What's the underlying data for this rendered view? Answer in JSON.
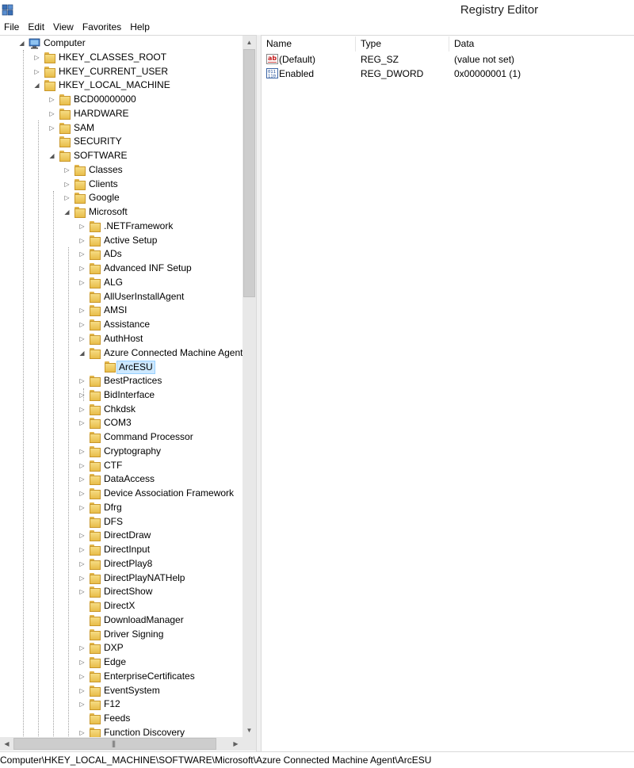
{
  "window": {
    "title": "Registry Editor"
  },
  "menu": [
    "File",
    "Edit",
    "View",
    "Favorites",
    "Help"
  ],
  "tree": [
    {
      "label": "Computer",
      "depth": 0,
      "state": "expanded",
      "icon": "computer-icon"
    },
    {
      "label": "HKEY_CLASSES_ROOT",
      "depth": 1,
      "state": "collapsed"
    },
    {
      "label": "HKEY_CURRENT_USER",
      "depth": 1,
      "state": "collapsed"
    },
    {
      "label": "HKEY_LOCAL_MACHINE",
      "depth": 1,
      "state": "expanded"
    },
    {
      "label": "BCD00000000",
      "depth": 2,
      "state": "collapsed"
    },
    {
      "label": "HARDWARE",
      "depth": 2,
      "state": "collapsed"
    },
    {
      "label": "SAM",
      "depth": 2,
      "state": "collapsed"
    },
    {
      "label": "SECURITY",
      "depth": 2,
      "state": "none"
    },
    {
      "label": "SOFTWARE",
      "depth": 2,
      "state": "expanded"
    },
    {
      "label": "Classes",
      "depth": 3,
      "state": "collapsed"
    },
    {
      "label": "Clients",
      "depth": 3,
      "state": "collapsed"
    },
    {
      "label": "Google",
      "depth": 3,
      "state": "collapsed"
    },
    {
      "label": "Microsoft",
      "depth": 3,
      "state": "expanded"
    },
    {
      "label": ".NETFramework",
      "depth": 4,
      "state": "collapsed"
    },
    {
      "label": "Active Setup",
      "depth": 4,
      "state": "collapsed"
    },
    {
      "label": "ADs",
      "depth": 4,
      "state": "collapsed"
    },
    {
      "label": "Advanced INF Setup",
      "depth": 4,
      "state": "collapsed"
    },
    {
      "label": "ALG",
      "depth": 4,
      "state": "collapsed"
    },
    {
      "label": "AllUserInstallAgent",
      "depth": 4,
      "state": "none"
    },
    {
      "label": "AMSI",
      "depth": 4,
      "state": "collapsed"
    },
    {
      "label": "Assistance",
      "depth": 4,
      "state": "collapsed"
    },
    {
      "label": "AuthHost",
      "depth": 4,
      "state": "collapsed"
    },
    {
      "label": "Azure Connected Machine Agent",
      "depth": 4,
      "state": "expanded"
    },
    {
      "label": "ArcESU",
      "depth": 5,
      "state": "none",
      "selected": true
    },
    {
      "label": "BestPractices",
      "depth": 4,
      "state": "collapsed"
    },
    {
      "label": "BidInterface",
      "depth": 4,
      "state": "collapsed"
    },
    {
      "label": "Chkdsk",
      "depth": 4,
      "state": "collapsed"
    },
    {
      "label": "COM3",
      "depth": 4,
      "state": "collapsed"
    },
    {
      "label": "Command Processor",
      "depth": 4,
      "state": "none"
    },
    {
      "label": "Cryptography",
      "depth": 4,
      "state": "collapsed"
    },
    {
      "label": "CTF",
      "depth": 4,
      "state": "collapsed"
    },
    {
      "label": "DataAccess",
      "depth": 4,
      "state": "collapsed"
    },
    {
      "label": "Device Association Framework",
      "depth": 4,
      "state": "collapsed"
    },
    {
      "label": "Dfrg",
      "depth": 4,
      "state": "collapsed"
    },
    {
      "label": "DFS",
      "depth": 4,
      "state": "none"
    },
    {
      "label": "DirectDraw",
      "depth": 4,
      "state": "collapsed"
    },
    {
      "label": "DirectInput",
      "depth": 4,
      "state": "collapsed"
    },
    {
      "label": "DirectPlay8",
      "depth": 4,
      "state": "collapsed"
    },
    {
      "label": "DirectPlayNATHelp",
      "depth": 4,
      "state": "collapsed"
    },
    {
      "label": "DirectShow",
      "depth": 4,
      "state": "collapsed"
    },
    {
      "label": "DirectX",
      "depth": 4,
      "state": "none"
    },
    {
      "label": "DownloadManager",
      "depth": 4,
      "state": "none"
    },
    {
      "label": "Driver Signing",
      "depth": 4,
      "state": "none"
    },
    {
      "label": "DXP",
      "depth": 4,
      "state": "collapsed"
    },
    {
      "label": "Edge",
      "depth": 4,
      "state": "collapsed"
    },
    {
      "label": "EnterpriseCertificates",
      "depth": 4,
      "state": "collapsed"
    },
    {
      "label": "EventSystem",
      "depth": 4,
      "state": "collapsed"
    },
    {
      "label": "F12",
      "depth": 4,
      "state": "collapsed"
    },
    {
      "label": "Feeds",
      "depth": 4,
      "state": "none"
    },
    {
      "label": "Function Discovery",
      "depth": 4,
      "state": "collapsed"
    }
  ],
  "list": {
    "columns": [
      "Name",
      "Type",
      "Data"
    ],
    "rows": [
      {
        "name": "(Default)",
        "type": "REG_SZ",
        "data": "(value not set)",
        "icon": "string-value-icon"
      },
      {
        "name": "Enabled",
        "type": "REG_DWORD",
        "data": "0x00000001 (1)",
        "icon": "binary-value-icon"
      }
    ]
  },
  "status": {
    "path": "Computer\\HKEY_LOCAL_MACHINE\\SOFTWARE\\Microsoft\\Azure Connected Machine Agent\\ArcESU"
  },
  "colors": {
    "selection_bg": "#cce8ff",
    "selection_border": "#99d1ff",
    "folder": "#e8bd4a"
  }
}
